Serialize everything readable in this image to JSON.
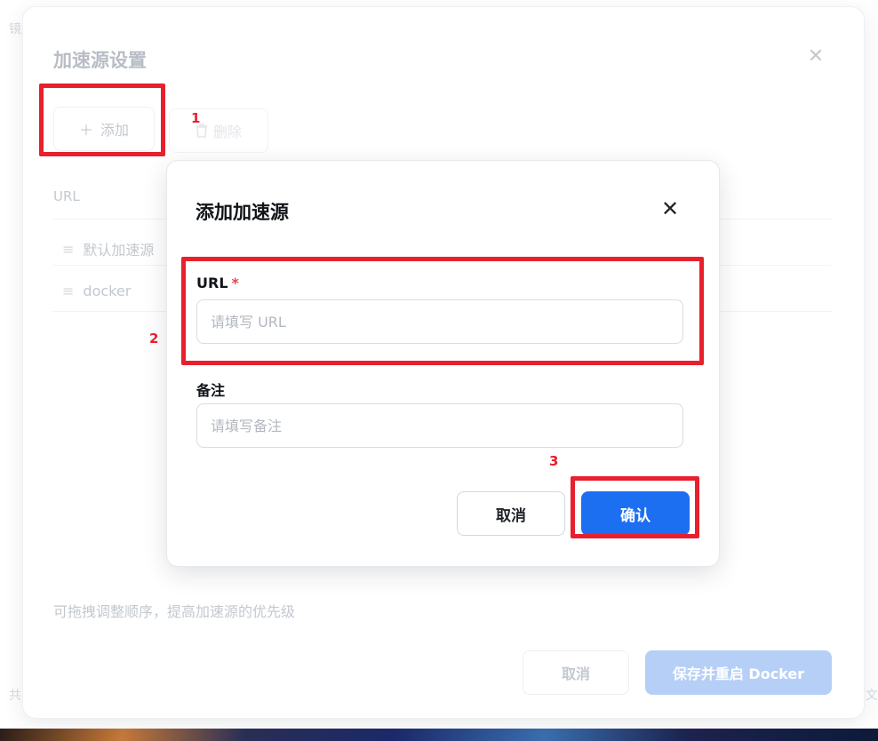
{
  "background": {
    "fragment_top_left": "镜",
    "fragment_bottom_left": "共",
    "fragment_bottom_right": "文"
  },
  "outer_dialog": {
    "title": "加速源设置",
    "close_icon": "close-icon",
    "toolbar": {
      "add_icon": "＋",
      "add_label": "添加",
      "delete_label": "删除"
    },
    "table": {
      "column_header": "URL",
      "rows": [
        {
          "drag_icon": "≡",
          "url": "默认加速源"
        },
        {
          "drag_icon": "≡",
          "url": "docker"
        }
      ]
    },
    "hint": "可拖拽调整顺序，提高加速源的优先级",
    "footer": {
      "cancel_label": "取消",
      "save_label": "保存并重启 Docker"
    }
  },
  "inner_dialog": {
    "title": "添加加速源",
    "close_icon": "close-icon",
    "url_field": {
      "label": "URL",
      "required_mark": "*",
      "value": "",
      "placeholder": "请填写 URL"
    },
    "note_field": {
      "label": "备注",
      "value": "",
      "placeholder": "请填写备注"
    },
    "cancel_label": "取消",
    "confirm_label": "确认"
  },
  "annotations": {
    "step_1": "1",
    "step_2": "2",
    "step_3": "3",
    "color": "#e8202e"
  },
  "colors": {
    "primary": "#1d6ff2",
    "primary_disabled": "#b6cff6",
    "required": "#e5484d"
  }
}
